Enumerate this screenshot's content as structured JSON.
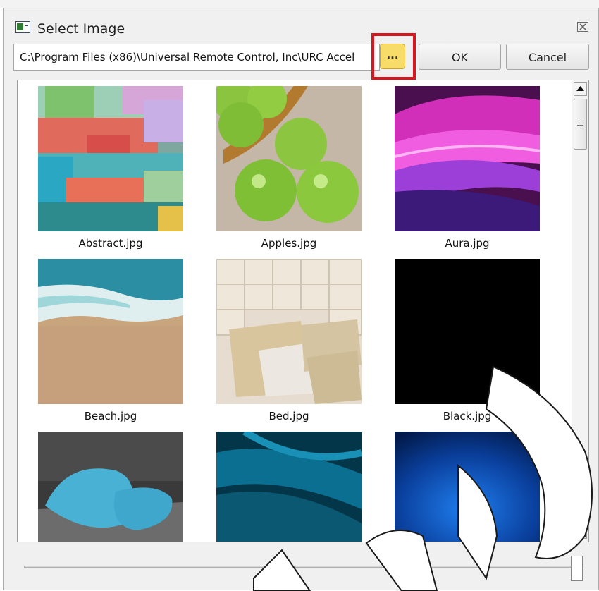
{
  "window": {
    "title": "Select Image",
    "app_icon": "app-window-icon",
    "close_icon": "close-icon"
  },
  "toolbar": {
    "path_value": "C:\\Program Files (x86)\\Universal Remote Control, Inc\\URC Accel",
    "browse_label": "...",
    "ok_label": "OK",
    "cancel_label": "Cancel",
    "highlight_color": "#d9161f"
  },
  "images": [
    {
      "name": "Abstract.jpg"
    },
    {
      "name": "Apples.jpg"
    },
    {
      "name": "Aura.jpg"
    },
    {
      "name": "Beach.jpg"
    },
    {
      "name": "Bed.jpg"
    },
    {
      "name": "Black.jpg"
    },
    {
      "name": ""
    },
    {
      "name": ""
    },
    {
      "name": ""
    }
  ],
  "scrollbar": {
    "up_icon": "scroll-up-arrow-icon",
    "down_icon": "scroll-down-arrow-icon"
  },
  "slider": {
    "level": 1.0
  }
}
